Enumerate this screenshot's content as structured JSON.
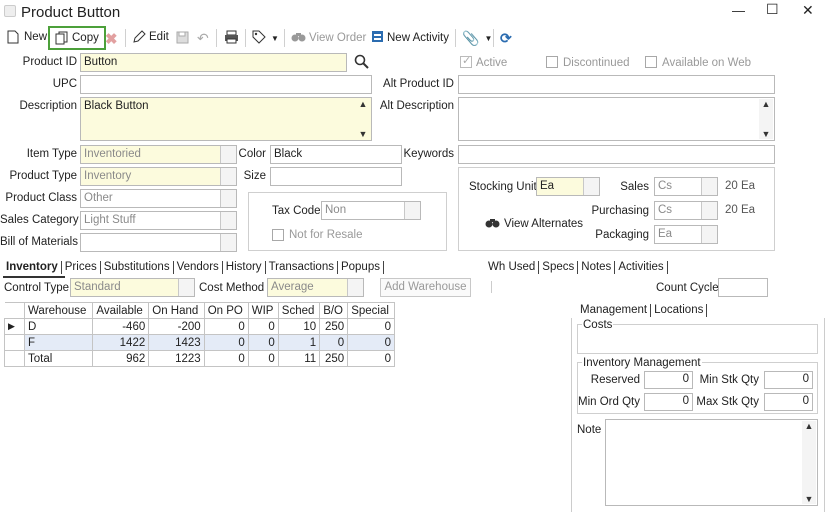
{
  "window": {
    "title": "Product Button",
    "minimize": "—",
    "maximize": "☐",
    "close": "✕"
  },
  "toolbar": {
    "new": "New",
    "copy": "Copy",
    "edit": "Edit",
    "view_order": "View Order",
    "new_activity": "New Activity"
  },
  "form": {
    "product_id_label": "Product ID",
    "product_id": "Button",
    "upc_label": "UPC",
    "upc": "",
    "description_label": "Description",
    "description": "Black Button",
    "active_label": "Active",
    "discontinued_label": "Discontinued",
    "available_web_label": "Available on Web",
    "alt_product_id_label": "Alt Product ID",
    "alt_product_id": "",
    "alt_description_label": "Alt Description",
    "alt_description": "",
    "item_type_label": "Item Type",
    "item_type": "Inventoried",
    "product_type_label": "Product Type",
    "product_type": "Inventory",
    "product_class_label": "Product Class",
    "product_class": "Other",
    "sales_category_label": "Sales Category",
    "sales_category": "Light Stuff",
    "bom_label": "Bill of Materials",
    "bom": "",
    "color_label": "Color",
    "color": "Black",
    "size_label": "Size",
    "size": "",
    "keywords_label": "Keywords",
    "keywords": "",
    "tax_code_label": "Tax Code",
    "tax_code": "Non",
    "not_for_resale_label": "Not for Resale",
    "stocking_unit_label": "Stocking Unit",
    "stocking_unit": "Ea",
    "sales_label": "Sales",
    "sales_unit": "Cs",
    "sales_qty": "20 Ea",
    "purchasing_label": "Purchasing",
    "purchasing_unit": "Cs",
    "purchasing_qty": "20 Ea",
    "packaging_label": "Packaging",
    "packaging_unit": "Ea",
    "view_alternates": "View Alternates"
  },
  "tabs_left": [
    "Inventory",
    "Prices",
    "Substitutions",
    "Vendors",
    "History",
    "Transactions",
    "Popups"
  ],
  "tabs_right": [
    "Wh Used",
    "Specs",
    "Notes",
    "Activities"
  ],
  "inventory": {
    "control_type_label": "Control Type",
    "control_type": "Standard",
    "cost_method_label": "Cost Method",
    "cost_method": "Average",
    "add_warehouse": "Add Warehouse",
    "count_cycle_label": "Count Cycle",
    "count_cycle": "",
    "headers": [
      "Warehouse",
      "Available",
      "On Hand",
      "On PO",
      "WIP",
      "Sched",
      "B/O",
      "Special"
    ],
    "rows": [
      [
        "D",
        "-460",
        "-200",
        "0",
        "0",
        "10",
        "250",
        "0"
      ],
      [
        "F",
        "1422",
        "1423",
        "0",
        "0",
        "1",
        "0",
        "0"
      ],
      [
        "Total",
        "962",
        "1223",
        "0",
        "0",
        "11",
        "250",
        "0"
      ]
    ]
  },
  "right_panel": {
    "tabs": [
      "Management",
      "Locations"
    ],
    "costs_label": "Costs",
    "inv_mgmt_label": "Inventory Management",
    "reserved_label": "Reserved",
    "reserved": "0",
    "min_stk_label": "Min Stk Qty",
    "min_stk": "0",
    "min_ord_label": "Min Ord Qty",
    "min_ord": "0",
    "max_stk_label": "Max Stk Qty",
    "max_stk": "0",
    "note_label": "Note",
    "note": ""
  }
}
